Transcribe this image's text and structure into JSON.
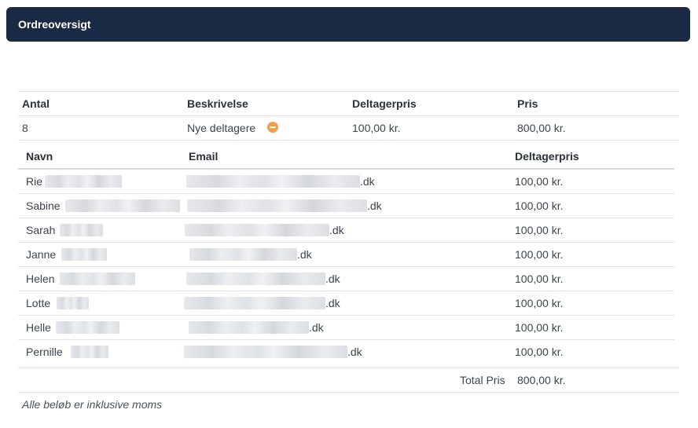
{
  "header": {
    "title": "Ordreoversigt"
  },
  "order_table": {
    "columns": [
      "Antal",
      "Beskrivelse",
      "Deltagerpris",
      "Pris"
    ],
    "row": {
      "antal": "8",
      "beskrivelse": "Nye deltagere",
      "deltagerpris": "100,00 kr.",
      "pris": "800,00 kr."
    }
  },
  "participants": {
    "columns": [
      "Navn",
      "Email",
      "Deltagerpris"
    ],
    "rows": [
      {
        "first_name": "Rie",
        "email_suffix": ".dk",
        "price": "100,00 kr."
      },
      {
        "first_name": "Sabine",
        "email_suffix": ".dk",
        "price": "100,00 kr."
      },
      {
        "first_name": "Sarah",
        "email_suffix": ".dk",
        "price": "100,00 kr."
      },
      {
        "first_name": "Janne",
        "email_suffix": ".dk",
        "price": "100,00 kr."
      },
      {
        "first_name": "Helen",
        "email_suffix": ".dk",
        "price": "100,00 kr."
      },
      {
        "first_name": "Lotte",
        "email_suffix": ".dk",
        "price": "100,00 kr."
      },
      {
        "first_name": "Helle",
        "email_suffix": ".dk",
        "price": "100,00 kr."
      },
      {
        "first_name": "Pernille",
        "email_suffix": ".dk",
        "price": "100,00 kr."
      }
    ]
  },
  "total": {
    "label": "Total Pris",
    "value": "800,00 kr."
  },
  "footer_note": "Alle beløb er inklusive moms"
}
